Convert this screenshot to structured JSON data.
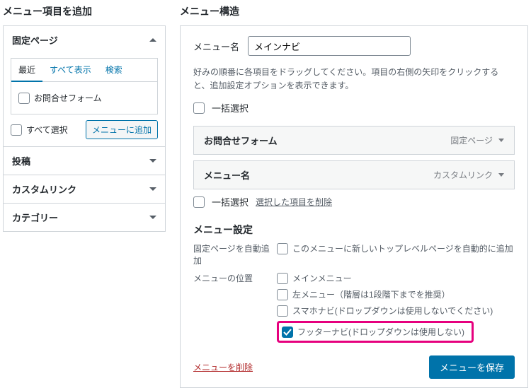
{
  "left": {
    "title": "メニュー項目を追加",
    "accordions": [
      {
        "label": "固定ページ",
        "open": true
      },
      {
        "label": "投稿",
        "open": false
      },
      {
        "label": "カスタムリンク",
        "open": false
      },
      {
        "label": "カテゴリー",
        "open": false
      }
    ],
    "tabs": {
      "recent": "最近",
      "all": "すべて表示",
      "search": "検索"
    },
    "page_item": "お問合せフォーム",
    "select_all": "すべて選択",
    "add_button": "メニューに追加"
  },
  "right": {
    "title": "メニュー構造",
    "name_label": "メニュー名",
    "name_value": "メインナビ",
    "help": "好みの順番に各項目をドラッグしてください。項目の右側の矢印をクリックすると、追加設定オプションを表示できます。",
    "bulk_select": "一括選択",
    "bulk_delete": "選択した項目を削除",
    "items": [
      {
        "title": "お問合せフォーム",
        "type": "固定ページ"
      },
      {
        "title": "メニュー名",
        "type": "カスタムリンク"
      }
    ],
    "settings_title": "メニュー設定",
    "auto_add": {
      "label": "固定ページを自動追加",
      "option": "このメニューに新しいトップレベルページを自動的に追加"
    },
    "locations": {
      "label": "メニューの位置",
      "options": [
        {
          "text": "メインメニュー",
          "checked": false
        },
        {
          "text": "左メニュー（階層は1段階下までを推奨）",
          "checked": false
        },
        {
          "text": "スマホナビ(ドロップダウンは使用しないでください)",
          "checked": false
        },
        {
          "text": "フッターナビ(ドロップダウンは使用しない)",
          "checked": true,
          "highlight": true
        }
      ]
    },
    "delete_menu": "メニューを削除",
    "save_menu": "メニューを保存"
  }
}
